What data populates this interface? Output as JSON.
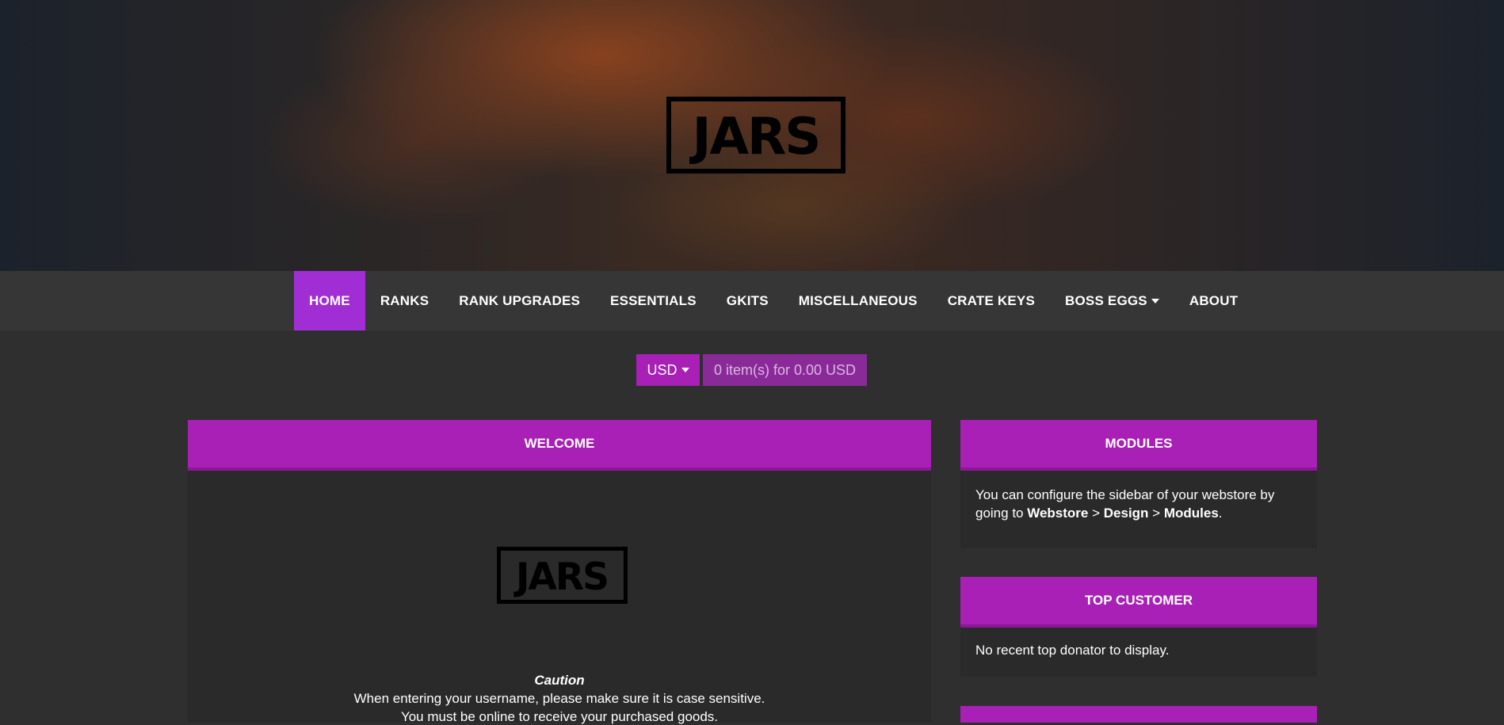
{
  "brand": {
    "logo_text": "JARS",
    "accent": "#a820b6",
    "active_nav": "#a12ed4"
  },
  "nav": {
    "items": [
      {
        "label": "HOME",
        "active": true
      },
      {
        "label": "RANKS"
      },
      {
        "label": "RANK UPGRADES"
      },
      {
        "label": "ESSENTIALS"
      },
      {
        "label": "GKITS"
      },
      {
        "label": "MISCELLANEOUS"
      },
      {
        "label": "CRATE KEYS"
      },
      {
        "label": "BOSS EGGS",
        "dropdown": true
      },
      {
        "label": "ABOUT"
      }
    ]
  },
  "currency": {
    "selected": "USD"
  },
  "cart": {
    "summary": "0 item(s) for 0.00 USD"
  },
  "welcome": {
    "title": "WELCOME",
    "caution": "Caution",
    "line1": "When entering your username, please make sure it is case sensitive.",
    "line2": "You must be online to receive your purchased goods."
  },
  "modules": {
    "title": "MODULES",
    "text_prefix": "You can configure the sidebar of your webstore by going to ",
    "path1": "Webstore",
    "sep1": " > ",
    "path2": "Design",
    "sep2": " > ",
    "path3": "Modules",
    "suffix": "."
  },
  "top_customer": {
    "title": "TOP CUSTOMER",
    "text": "No recent top donator to display."
  }
}
